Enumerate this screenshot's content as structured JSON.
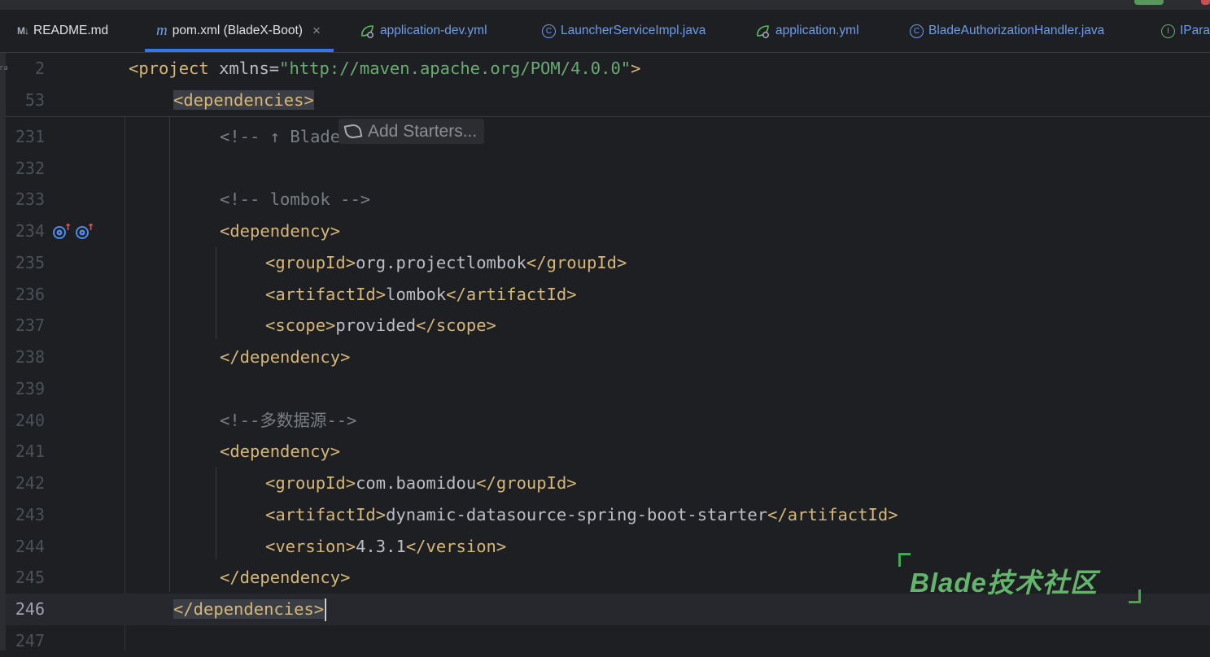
{
  "editor": {
    "tabs": [
      {
        "label": "README.md",
        "icon": "md-file-icon"
      },
      {
        "label": "pom.xml (BladeX-Boot)",
        "icon": "maven-icon",
        "active": true
      },
      {
        "label": "application-dev.yml",
        "icon": "spring-yml-icon"
      },
      {
        "label": "LauncherServiceImpl.java",
        "icon": "class-icon"
      },
      {
        "label": "application.yml",
        "icon": "spring-yml-icon"
      },
      {
        "label": "BladeAuthorizationHandler.java",
        "icon": "class-icon"
      },
      {
        "label": "IPara",
        "icon": "interface-icon"
      }
    ],
    "close_glyph": "×",
    "left_edge_fragment": "ra",
    "sticky_lines": [
      {
        "num": "2",
        "parts": [
          "<project",
          " xmlns=",
          "\"http://maven.apache.org/POM/4.0.0\""
        ]
      },
      {
        "num": "53",
        "parts": [
          "<dependencies>"
        ]
      }
    ],
    "add_starters_label": "Add Starters...",
    "lines": [
      {
        "num": "231",
        "text": "<!-- ↑ BladeX依赖库 ↑ -->"
      },
      {
        "num": "232",
        "text": ""
      },
      {
        "num": "233",
        "text": "<!-- lombok -->"
      },
      {
        "num": "234",
        "text": "<dependency>"
      },
      {
        "num": "235",
        "parts": [
          "<groupId>",
          "org.projectlombok",
          "</groupId>"
        ]
      },
      {
        "num": "236",
        "parts": [
          "<artifactId>",
          "lombok",
          "</artifactId>"
        ]
      },
      {
        "num": "237",
        "parts": [
          "<scope>",
          "provided",
          "</scope>"
        ]
      },
      {
        "num": "238",
        "text": "</dependency>"
      },
      {
        "num": "239",
        "text": ""
      },
      {
        "num": "240",
        "text": "<!--多数据源-->"
      },
      {
        "num": "241",
        "text": "<dependency>"
      },
      {
        "num": "242",
        "parts": [
          "<groupId>",
          "com.baomidou",
          "</groupId>"
        ]
      },
      {
        "num": "243",
        "parts": [
          "<artifactId>",
          "dynamic-datasource-spring-boot-starter",
          "</artifactId>"
        ]
      },
      {
        "num": "244",
        "parts": [
          "<version>",
          "4.3.1",
          "</version>"
        ]
      },
      {
        "num": "245",
        "text": "</dependency>"
      },
      {
        "num": "246",
        "text": "</dependencies>"
      },
      {
        "num": "247",
        "text": ""
      }
    ],
    "gutter_icons": [
      "implementation-up-icon",
      "implementation-up-icon"
    ],
    "watermark": "Blade技术社区"
  },
  "colors": {
    "background": "#1e1f22",
    "tag": "#d5b778",
    "string": "#6aab73",
    "comment": "#7a7e85",
    "accent": "#3574f0",
    "watermark": "#62b56a"
  }
}
